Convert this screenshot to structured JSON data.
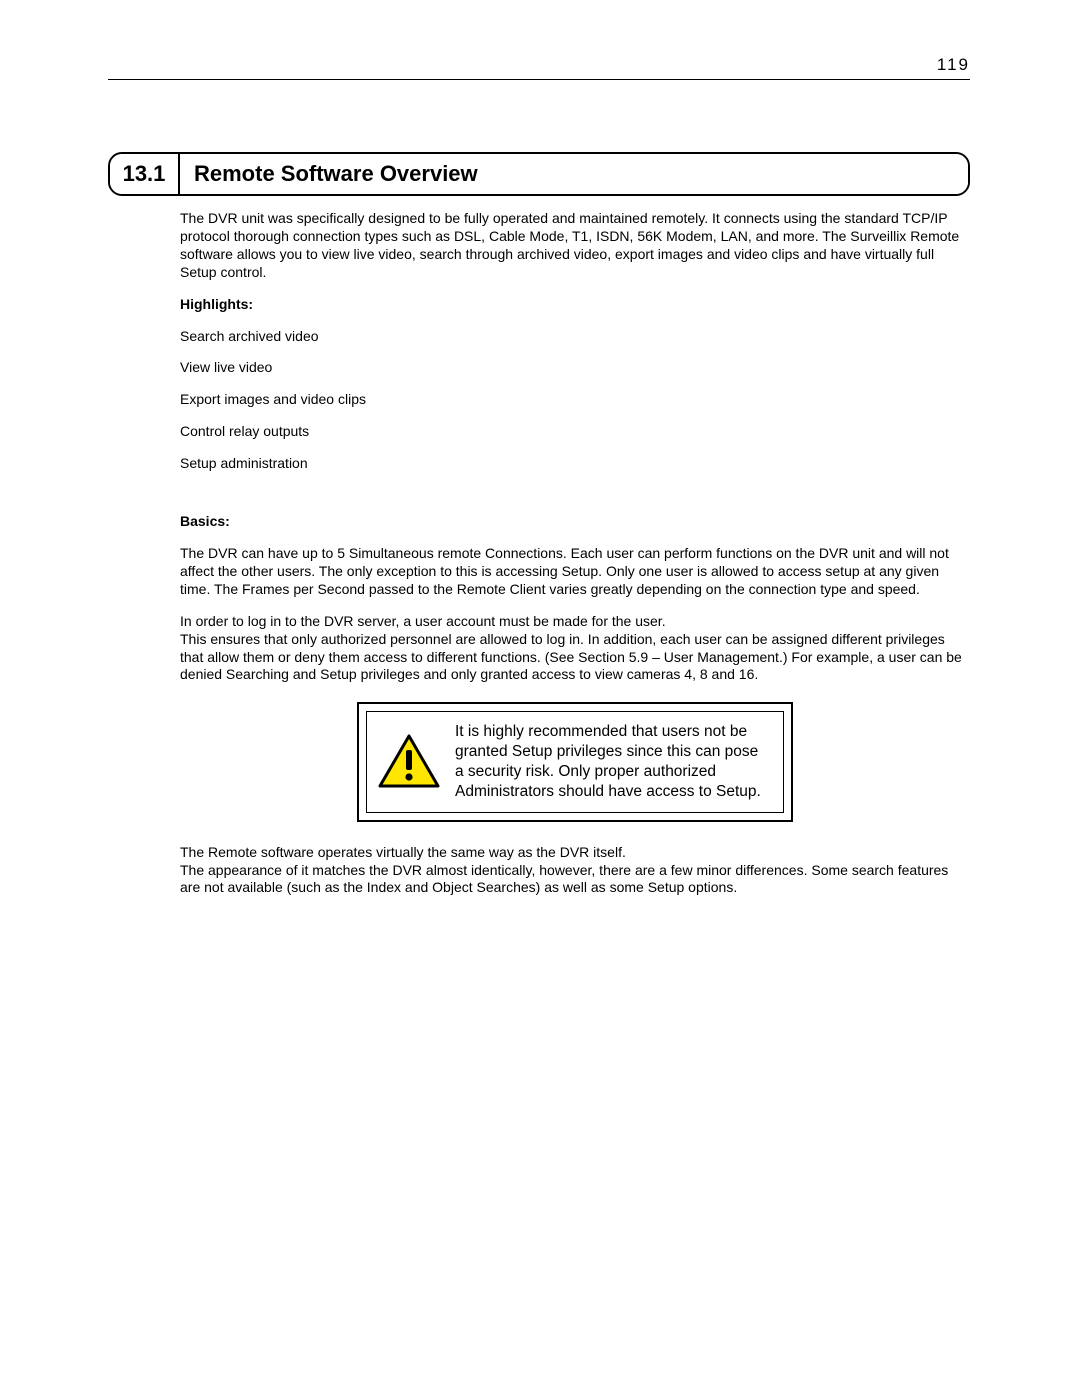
{
  "page_number": "119",
  "section": {
    "number": "13.1",
    "title": "Remote Software Overview"
  },
  "intro": "The DVR unit was specifically designed to be fully operated and maintained remotely. It connects using the standard TCP/IP protocol thorough connection types such as DSL, Cable Mode, T1, ISDN, 56K Modem, LAN, and more.  The Surveillix Remote software allows you to view live video, search through archived video, export images and video clips and have virtually full Setup control.",
  "highlights_label": "Highlights:",
  "highlights": [
    "Search archived video",
    "View live video",
    "Export images and video clips",
    "Control relay outputs",
    "Setup administration"
  ],
  "basics_label": "Basics:",
  "basics_p1": "The DVR can have up to 5 Simultaneous remote Connections. Each user can perform functions on the DVR unit and will not affect the other users. The only exception to this is accessing Setup. Only one user is allowed to access setup at any given time. The Frames per Second passed to the Remote Client varies greatly depending on the connection type and speed.",
  "basics_p2a": "In order to log in to the DVR server, a user account must be made for the user.",
  "basics_p2b": "This ensures that only authorized personnel are allowed to log in.  In addition, each user can be assigned different privileges that allow them or deny them access to different functions.  (See Section 5.9 – User Management.)  For example, a user can be denied Searching and Setup privileges and only granted access to view cameras 4, 8 and 16.",
  "callout": "It is highly recommended that users not be granted Setup privileges since this can pose a security risk.  Only proper authorized Administrators should have access to Setup.",
  "closing_a": "The Remote software operates virtually the same way as the DVR itself.",
  "closing_b": "The appearance of it matches the DVR almost identically, however, there are a few minor differences.  Some search features are not available (such as the Index and Object Searches) as well as some Setup options.",
  "icons": {
    "warning": "warning-triangle-icon"
  }
}
